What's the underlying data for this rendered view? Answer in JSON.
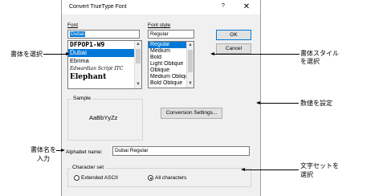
{
  "dialog": {
    "title": "Convert TrueType Font",
    "help_label": "?",
    "close_label": "✕"
  },
  "font": {
    "label": "Font",
    "value": "Dubai",
    "items": [
      "DFPOP1-W9",
      "Dubai",
      "Ebrima",
      "Edwardian Script ITC",
      "Elephant"
    ],
    "selected_index": 1
  },
  "style": {
    "label": "Font style",
    "value": "Regular",
    "items": [
      "Regular",
      "Medium",
      "Bold",
      "Light Oblique",
      "Oblique",
      "Medium Oblique",
      "Bold Oblique"
    ],
    "selected_index": 0
  },
  "buttons": {
    "ok": "OK",
    "cancel": "Cancel",
    "conversion": "Conversion Settings..."
  },
  "sample": {
    "label": "Sample",
    "text": "AaBbYyZz"
  },
  "alphabet": {
    "label": "Alphabet name:",
    "value": "Dubai Regular"
  },
  "charset": {
    "label": "Character set",
    "options": [
      "Extended ASCII",
      "All characters"
    ],
    "selected": "All characters"
  },
  "callouts": {
    "select_font": "書体を選択",
    "select_style_line1": "書体スタイル",
    "select_style_line2": "を選択",
    "set_values": "数値を設定",
    "font_name_line1": "書体名を",
    "font_name_line2": "入力",
    "charset_line1": "文字セットを",
    "charset_line2": "選択"
  },
  "colors": {
    "selection": "#0078d7",
    "dialog_bg": "#f0f0f0"
  }
}
